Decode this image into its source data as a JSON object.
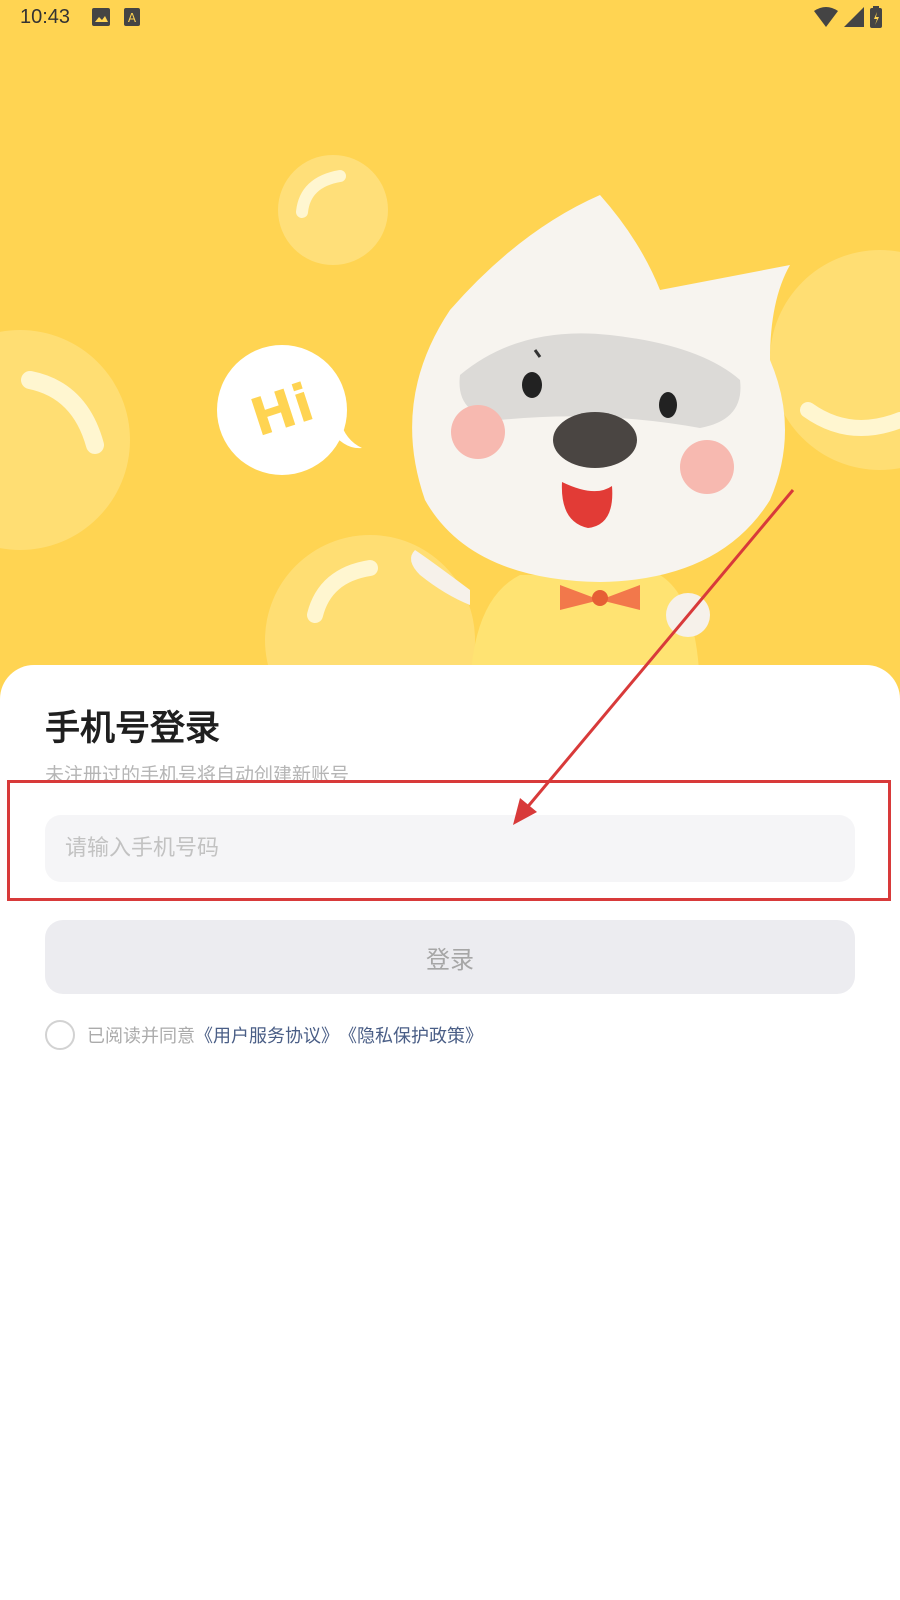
{
  "status_bar": {
    "time": "10:43",
    "left_icons": [
      "image-icon",
      "text-icon"
    ],
    "right_icons": [
      "wifi-icon",
      "signal-icon",
      "battery-icon"
    ]
  },
  "hero": {
    "background_color": "#ffd452",
    "bubble_text": "Hi",
    "mascot": "white-cat-mascot-icon"
  },
  "login": {
    "title": "手机号登录",
    "subtitle": "未注册过的手机号将自动创建新账号",
    "phone_placeholder": "请输入手机号码",
    "phone_value": "",
    "login_button_label": "登录",
    "agreement_prefix": "已阅读并同意",
    "user_agreement": "《用户服务协议》",
    "privacy_policy": "《隐私保护政策》"
  },
  "annotation": {
    "color": "#d83a3a"
  }
}
